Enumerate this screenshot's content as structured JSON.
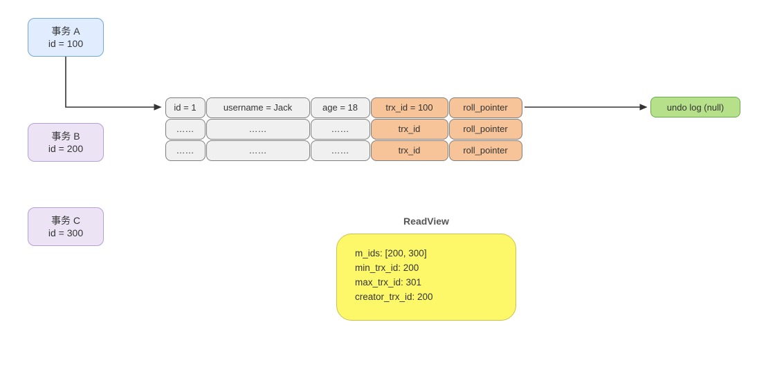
{
  "transactions": {
    "a": {
      "name": "事务 A",
      "id_line": "id = 100"
    },
    "b": {
      "name": "事务 B",
      "id_line": "id = 200"
    },
    "c": {
      "name": "事务 C",
      "id_line": "id = 300"
    }
  },
  "rows": [
    {
      "id": "id = 1",
      "user": "username = Jack",
      "age": "age = 18",
      "trx": "trx_id = 100",
      "roll": "roll_pointer"
    },
    {
      "id": "……",
      "user": "……",
      "age": "……",
      "trx": "trx_id",
      "roll": "roll_pointer"
    },
    {
      "id": "……",
      "user": "……",
      "age": "……",
      "trx": "trx_id",
      "roll": "roll_pointer"
    }
  ],
  "undo_log": "undo log (null)",
  "readview": {
    "title": "ReadView",
    "m_ids": "m_ids: [200, 300]",
    "min": "min_trx_id: 200",
    "max": "max_trx_id: 301",
    "creator": "creator_trx_id: 200"
  }
}
